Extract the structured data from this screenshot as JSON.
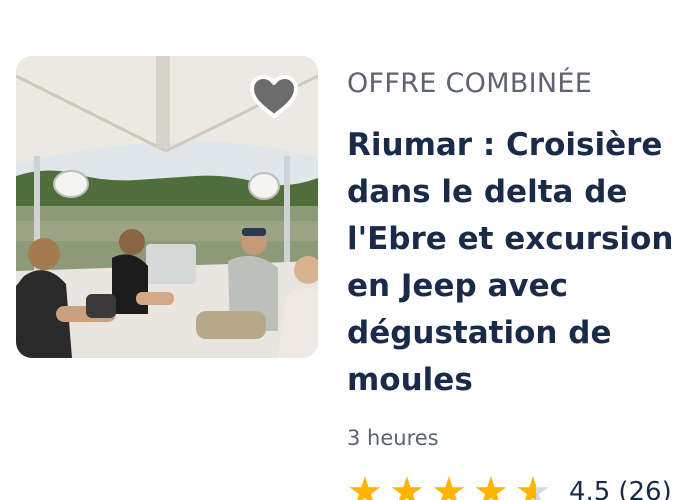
{
  "card": {
    "category": "OFFRE COMBINÉE",
    "title": "Riumar : Croisière dans le delta de l'Ebre et excursion en Jeep avec dégustation de moules",
    "duration": "3 heures",
    "rating": {
      "value": "4.5",
      "count": "(26)",
      "stars": 4.5
    },
    "wishlist_icon": "heart-icon"
  },
  "colors": {
    "title": "#1a2b49",
    "secondary_text": "#5d6370",
    "star": "#ffb400"
  }
}
